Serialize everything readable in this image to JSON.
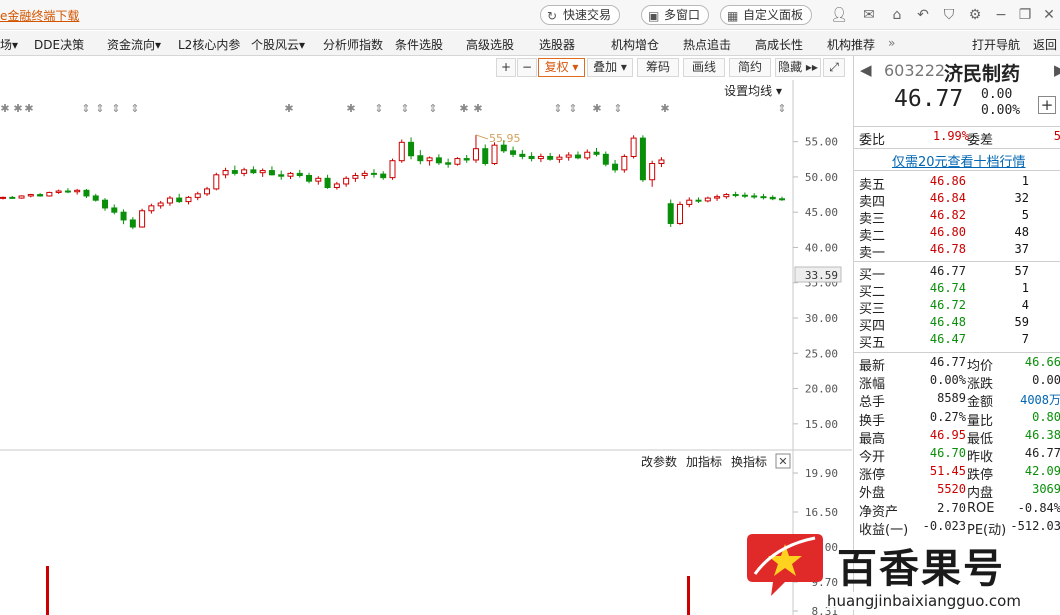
{
  "titlebar": {
    "download_link": "e金融终端下载",
    "quick_trade": "快速交易",
    "multi_window": "多窗口",
    "custom_panel": "自定义面板"
  },
  "menu": [
    "场▾",
    "DDE决策",
    "资金流向▾",
    "L2核心内参",
    "个股风云▾",
    "分析师指数",
    "条件选股",
    "高级选股",
    "选股器",
    "机构增仓",
    "热点追击",
    "高成长性",
    "机构推荐",
    "»",
    "打开导航",
    "返回"
  ],
  "chart_toolbar": {
    "plus": "+",
    "minus": "−",
    "fuquan": "复权 ▾",
    "diejia": "叠加 ▾",
    "chouma": "筹码",
    "huaxian": "画线",
    "jianyue": "简约",
    "yincang": "隐藏 ▸▸",
    "expand": "⤢"
  },
  "chart_labels": {
    "set_ma": "设置均线 ▾",
    "high_mark": "55.95",
    "current_price_tag": "33.59",
    "indicator_params": "改参数",
    "add_indicator": "加指标",
    "change_indicator": "换指标",
    "close": "✕"
  },
  "chart_data": {
    "type": "candlestick",
    "price_axis": [
      "55.00",
      "50.00",
      "45.00",
      "40.00",
      "35.00",
      "30.00",
      "25.00",
      "20.00",
      "15.00"
    ],
    "price_ylim": [
      12,
      57.5
    ],
    "volume_axis": [
      "19.90",
      "16.50",
      "13.00",
      "9.70",
      "8.31"
    ],
    "high_mark": 55.95,
    "candles": [
      [
        47.0,
        47.2,
        46.8,
        47.1
      ],
      [
        47.1,
        47.3,
        46.9,
        47.0
      ],
      [
        47.0,
        47.4,
        46.9,
        47.3
      ],
      [
        47.3,
        47.6,
        47.1,
        47.5
      ],
      [
        47.5,
        47.7,
        47.2,
        47.3
      ],
      [
        47.3,
        47.9,
        47.2,
        47.8
      ],
      [
        47.8,
        48.2,
        47.6,
        48.0
      ],
      [
        48.0,
        48.4,
        47.7,
        47.9
      ],
      [
        47.9,
        48.3,
        47.5,
        48.1
      ],
      [
        48.1,
        48.3,
        47.0,
        47.3
      ],
      [
        47.3,
        47.6,
        46.5,
        46.7
      ],
      [
        46.7,
        47.0,
        45.2,
        45.6
      ],
      [
        45.6,
        46.1,
        44.7,
        45.0
      ],
      [
        45.0,
        45.4,
        43.3,
        43.9
      ],
      [
        43.9,
        44.3,
        42.6,
        42.9
      ],
      [
        42.9,
        45.5,
        42.8,
        45.2
      ],
      [
        45.2,
        46.2,
        44.8,
        45.9
      ],
      [
        45.9,
        46.6,
        45.5,
        46.3
      ],
      [
        46.3,
        47.3,
        45.9,
        47.0
      ],
      [
        47.0,
        47.6,
        46.3,
        46.5
      ],
      [
        46.5,
        47.3,
        46.1,
        47.1
      ],
      [
        47.1,
        47.9,
        46.7,
        47.6
      ],
      [
        47.6,
        48.6,
        47.3,
        48.3
      ],
      [
        48.3,
        50.6,
        48.1,
        50.3
      ],
      [
        50.3,
        51.3,
        49.8,
        50.9
      ],
      [
        50.9,
        51.6,
        50.2,
        50.5
      ],
      [
        50.5,
        51.3,
        50.1,
        51.0
      ],
      [
        51.0,
        51.5,
        50.4,
        50.6
      ],
      [
        50.6,
        51.2,
        50.0,
        50.9
      ],
      [
        50.9,
        51.5,
        50.2,
        50.3
      ],
      [
        50.3,
        50.9,
        49.6,
        50.1
      ],
      [
        50.1,
        50.7,
        49.7,
        50.5
      ],
      [
        50.5,
        51.0,
        49.9,
        50.2
      ],
      [
        50.2,
        50.6,
        49.1,
        49.4
      ],
      [
        49.4,
        50.1,
        48.9,
        49.8
      ],
      [
        49.8,
        50.3,
        48.3,
        48.5
      ],
      [
        48.5,
        49.3,
        48.2,
        49.0
      ],
      [
        49.0,
        50.1,
        48.6,
        49.8
      ],
      [
        49.8,
        50.6,
        49.3,
        50.2
      ],
      [
        50.2,
        50.9,
        49.7,
        50.5
      ],
      [
        50.5,
        51.1,
        49.9,
        50.4
      ],
      [
        50.4,
        50.8,
        49.6,
        49.9
      ],
      [
        49.9,
        52.6,
        49.6,
        52.3
      ],
      [
        52.3,
        55.3,
        52.0,
        54.9
      ],
      [
        54.9,
        55.6,
        52.5,
        53.0
      ],
      [
        53.0,
        53.8,
        51.8,
        52.3
      ],
      [
        52.3,
        52.9,
        51.6,
        52.7
      ],
      [
        52.7,
        53.2,
        51.7,
        52.0
      ],
      [
        52.0,
        52.6,
        51.3,
        51.8
      ],
      [
        51.8,
        52.8,
        51.6,
        52.6
      ],
      [
        52.6,
        53.1,
        52.0,
        52.4
      ],
      [
        52.4,
        55.95,
        52.0,
        54.0
      ],
      [
        54.0,
        54.6,
        51.6,
        51.9
      ],
      [
        51.9,
        54.9,
        51.7,
        54.5
      ],
      [
        54.5,
        55.2,
        53.4,
        53.7
      ],
      [
        53.7,
        54.3,
        52.8,
        53.2
      ],
      [
        53.2,
        53.8,
        52.5,
        52.9
      ],
      [
        52.9,
        53.5,
        52.2,
        52.6
      ],
      [
        52.6,
        53.3,
        52.1,
        52.9
      ],
      [
        52.9,
        53.4,
        52.3,
        52.5
      ],
      [
        52.5,
        53.2,
        52.0,
        52.8
      ],
      [
        52.8,
        53.5,
        52.3,
        53.1
      ],
      [
        53.1,
        53.6,
        52.5,
        52.7
      ],
      [
        52.7,
        53.9,
        52.4,
        53.5
      ],
      [
        53.5,
        54.1,
        52.9,
        53.2
      ],
      [
        53.2,
        53.6,
        51.5,
        51.8
      ],
      [
        51.8,
        52.4,
        50.6,
        51.0
      ],
      [
        51.0,
        53.2,
        50.6,
        52.9
      ],
      [
        52.9,
        55.9,
        52.6,
        55.5
      ],
      [
        55.5,
        55.9,
        49.3,
        49.6
      ],
      [
        49.6,
        52.3,
        48.6,
        51.9
      ],
      [
        51.9,
        52.8,
        51.4,
        52.4
      ],
      [
        46.2,
        46.8,
        42.9,
        43.4
      ],
      [
        43.4,
        46.5,
        43.2,
        46.1
      ],
      [
        46.1,
        47.1,
        45.7,
        46.7
      ],
      [
        46.7,
        47.1,
        46.3,
        46.6
      ],
      [
        46.6,
        47.2,
        46.4,
        47.0
      ],
      [
        47.0,
        47.5,
        46.6,
        47.2
      ],
      [
        47.2,
        47.7,
        46.9,
        47.5
      ],
      [
        47.5,
        47.9,
        47.1,
        47.4
      ],
      [
        47.4,
        47.8,
        47.0,
        47.3
      ],
      [
        47.3,
        47.7,
        46.9,
        47.2
      ],
      [
        47.2,
        47.6,
        46.8,
        47.1
      ],
      [
        47.1,
        47.4,
        46.7,
        46.9
      ],
      [
        46.9,
        47.2,
        46.6,
        46.77
      ]
    ]
  },
  "stock": {
    "code": "603222",
    "name": "济民制药",
    "price": "46.77",
    "change": "0.00",
    "change_pct": "0.00%",
    "weibi_label": "委比",
    "weibi": "1.99%",
    "weicha_label": "委差",
    "weicha": "5",
    "promo": "仅需20元查看十档行情"
  },
  "asks": [
    {
      "label": "卖五",
      "price": "46.86",
      "vol": "1"
    },
    {
      "label": "卖四",
      "price": "46.84",
      "vol": "32"
    },
    {
      "label": "卖三",
      "price": "46.82",
      "vol": "5"
    },
    {
      "label": "卖二",
      "price": "46.80",
      "vol": "48"
    },
    {
      "label": "卖一",
      "price": "46.78",
      "vol": "37"
    }
  ],
  "bids": [
    {
      "label": "买一",
      "price": "46.77",
      "vol": "57"
    },
    {
      "label": "买二",
      "price": "46.74",
      "vol": "1"
    },
    {
      "label": "买三",
      "price": "46.72",
      "vol": "4"
    },
    {
      "label": "买四",
      "price": "46.48",
      "vol": "59"
    },
    {
      "label": "买五",
      "price": "46.47",
      "vol": "7"
    }
  ],
  "stats": [
    {
      "l1": "最新",
      "v1": "46.77",
      "c1": "",
      "l2": "均价",
      "v2": "46.66",
      "c2": "green"
    },
    {
      "l1": "涨幅",
      "v1": "0.00%",
      "c1": "",
      "l2": "涨跌",
      "v2": "0.00",
      "c2": ""
    },
    {
      "l1": "总手",
      "v1": "8589",
      "c1": "",
      "l2": "金额",
      "v2": "4008万",
      "c2": "blue"
    },
    {
      "l1": "换手",
      "v1": "0.27%",
      "c1": "",
      "l2": "量比",
      "v2": "0.80",
      "c2": "green"
    },
    {
      "l1": "最高",
      "v1": "46.95",
      "c1": "red",
      "l2": "最低",
      "v2": "46.38",
      "c2": "green"
    },
    {
      "l1": "今开",
      "v1": "46.70",
      "c1": "green",
      "l2": "昨收",
      "v2": "46.77",
      "c2": ""
    },
    {
      "l1": "涨停",
      "v1": "51.45",
      "c1": "red",
      "l2": "跌停",
      "v2": "42.09",
      "c2": "green"
    },
    {
      "l1": "外盘",
      "v1": "5520",
      "c1": "red",
      "l2": "内盘",
      "v2": "3069",
      "c2": "green"
    },
    {
      "l1": "净资产",
      "v1": "2.70",
      "c1": "",
      "l2": "ROE",
      "v2": "-0.84%",
      "c2": ""
    },
    {
      "l1": "收益(一)",
      "v1": "-0.023",
      "c1": "",
      "l2": "PE(动)",
      "v2": "-512.03",
      "c2": ""
    }
  ],
  "watermark": {
    "brand": "百香果号",
    "url": "huangjinbaixiangguo.com"
  }
}
